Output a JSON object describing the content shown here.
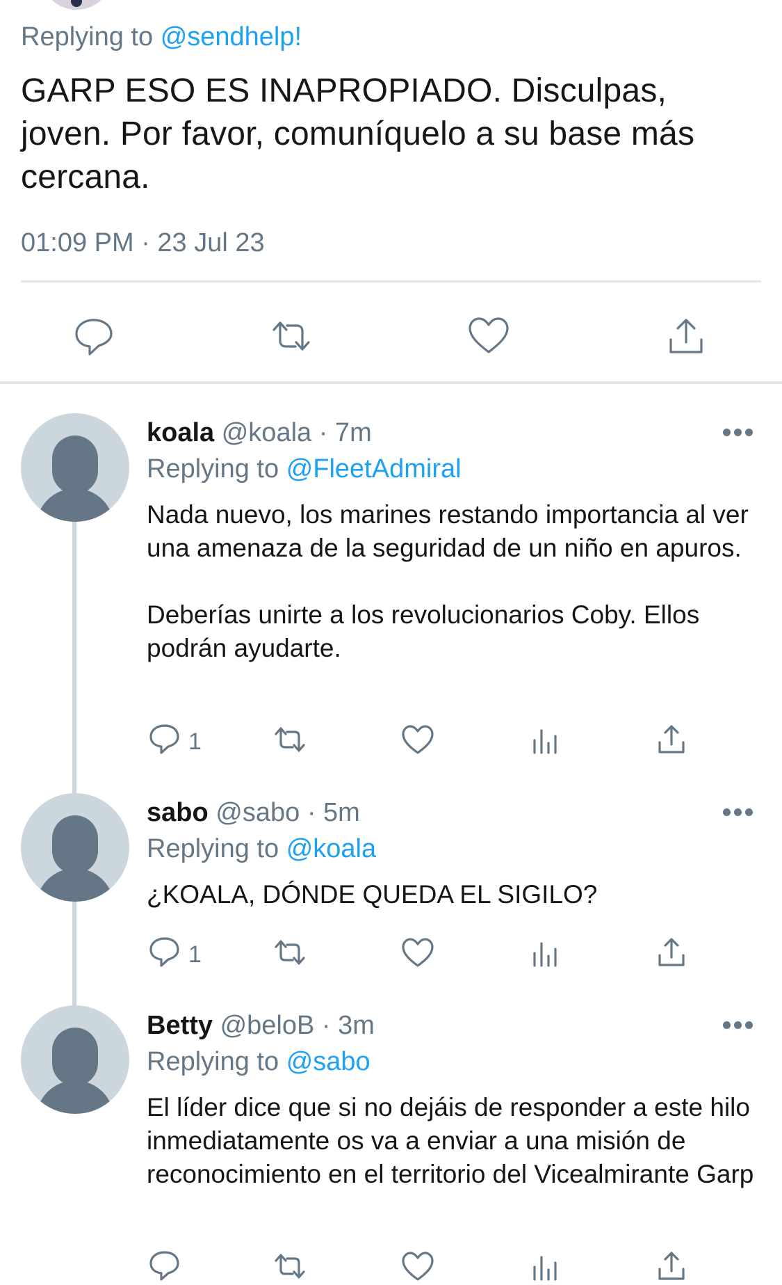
{
  "main_tweet": {
    "replying_prefix": "Replying to",
    "replying_handle": "@sendhelp!",
    "text": "GARP ESO ES INAPROPIADO. Disculpas, joven. Por favor, comuníquelo a su base más cercana.",
    "timestamp": "01:09 PM · 23 Jul 23",
    "actions": [
      "reply-icon",
      "retweet-icon",
      "like-icon",
      "share-icon"
    ]
  },
  "replies": [
    {
      "name": "koala",
      "handle": "@koala",
      "time": "· 7m",
      "replying_prefix": "Replying to",
      "replying_handle": "@FleetAdmiral",
      "text": "Nada nuevo, los marines restando importancia al ver una amenaza de la seguridad de un niño en apuros.\n\nDeberías unirte a los revolucionarios Coby. Ellos podrán ayudarte.",
      "reply_count": "1"
    },
    {
      "name": "sabo",
      "handle": "@sabo",
      "time": "· 5m",
      "replying_prefix": "Replying to",
      "replying_handle": "@koala",
      "text": "¿KOALA, DÓNDE QUEDA EL SIGILO?",
      "reply_count": "1"
    },
    {
      "name": "Betty",
      "handle": "@beloB",
      "time": "· 3m",
      "replying_prefix": "Replying to",
      "replying_handle": "@sabo",
      "text": "El líder dice que si no dejáis de responder a este hilo inmediatamente os va a enviar a una misión de reconocimiento en el territorio del Vicealmirante Garp",
      "reply_count": ""
    }
  ],
  "colors": {
    "accent": "#1da1f2",
    "secondary_text": "#657786",
    "avatar_bg": "#ccd6dd",
    "divider": "#e1e8ed"
  }
}
